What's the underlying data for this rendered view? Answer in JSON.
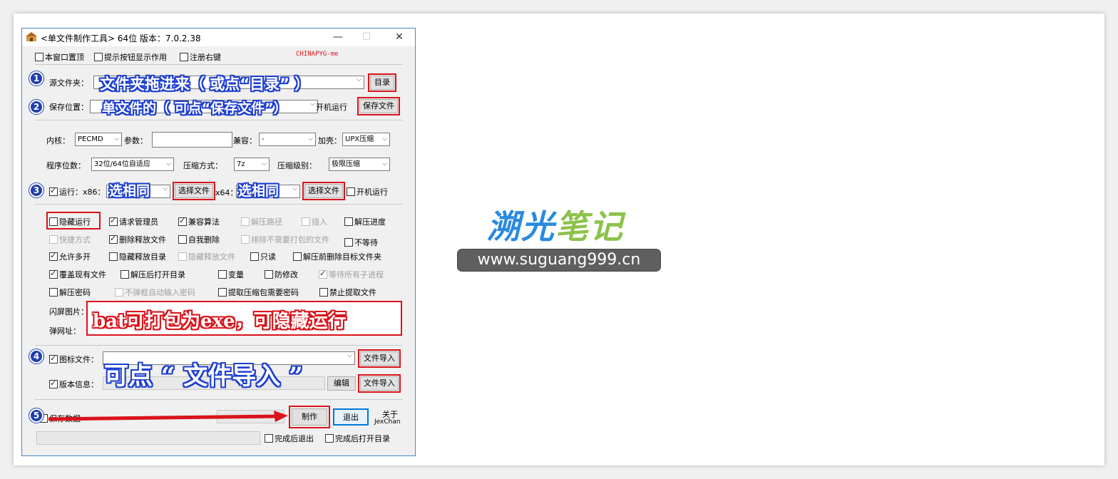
{
  "window": {
    "title": "<单文件制作工具> 64位 版本：7.0.2.38",
    "watermark": "CHINAPYG-me"
  },
  "top_options": [
    "本窗口置顶",
    "提示按钮显示作用",
    "注册右键"
  ],
  "rows": {
    "source_label": "源文件夹：",
    "source_button": "目录",
    "save_label": "保存位置：",
    "autostart_label": "开机运行",
    "save_button": "保存文件"
  },
  "settings": {
    "kernel_label": "内核：",
    "kernel_value": "PECMD",
    "params_label": "参数：",
    "compat_label": "兼容：",
    "compat_value": "-",
    "shell_label": "加壳：",
    "shell_value": "UPX压缩",
    "bits_label": "程序位数：",
    "bits_value": "32位/64位自适应",
    "compress_label": "压缩方式：",
    "compress_value": "7z",
    "level_label": "压缩级别：",
    "level_value": "极限压缩"
  },
  "run_row": {
    "run_label": "运行：x86：",
    "select_button_1": "选择文件",
    "x64_label": "x64：",
    "select_button_2": "选择文件",
    "autostart": "开机运行"
  },
  "options": [
    {
      "label": "隐藏运行",
      "checked": false,
      "disabled": false
    },
    {
      "label": "请求管理员",
      "checked": true,
      "disabled": false
    },
    {
      "label": "兼容算法",
      "checked": true,
      "disabled": false
    },
    {
      "label": "解压路径",
      "checked": false,
      "disabled": true
    },
    {
      "label": "插入",
      "checked": false,
      "disabled": true
    },
    {
      "label": "解压进度",
      "checked": false,
      "disabled": false
    },
    {
      "label": "快捷方式",
      "checked": false,
      "disabled": true
    },
    {
      "label": "删除释放文件",
      "checked": true,
      "disabled": false
    },
    {
      "label": "自我删除",
      "checked": false,
      "disabled": false
    },
    {
      "label": "排除不需要打包的文件",
      "checked": false,
      "disabled": true
    },
    {
      "label": "不等待",
      "checked": false,
      "disabled": false
    },
    {
      "label": "允许多开",
      "checked": true,
      "disabled": false
    },
    {
      "label": "隐藏释放目录",
      "checked": false,
      "disabled": false
    },
    {
      "label": "隐藏释放文件",
      "checked": false,
      "disabled": true
    },
    {
      "label": "只读",
      "checked": false,
      "disabled": false
    },
    {
      "label": "解压前删除目标文件夹",
      "checked": false,
      "disabled": false
    },
    {
      "label": "覆盖现有文件",
      "checked": true,
      "disabled": false
    },
    {
      "label": "解压后打开目录",
      "checked": false,
      "disabled": false
    },
    {
      "label": "变量",
      "checked": false,
      "disabled": false
    },
    {
      "label": "防修改",
      "checked": false,
      "disabled": false
    },
    {
      "label": "等待所有子进程",
      "checked": true,
      "disabled": true
    },
    {
      "label": "解压密码",
      "checked": false,
      "disabled": false
    },
    {
      "label": "不弹框自动输入密码",
      "checked": false,
      "disabled": true
    },
    {
      "label": "提取压缩包需要密码",
      "checked": false,
      "disabled": false
    },
    {
      "label": "禁止提取文件",
      "checked": false,
      "disabled": false
    }
  ],
  "splash_label": "闪屏图片：",
  "popup_label": "弹网址：",
  "icon_label": "图标文件：",
  "import_button_1": "文件导入",
  "version_label": "版本信息：",
  "edit_button": "编辑",
  "import_button_2": "文件导入",
  "bottom": {
    "save_data": "保存数据",
    "make_button": "制作",
    "exit_button": "退出",
    "about_1": "关于",
    "about_2": "JexChan",
    "done_exit": "完成后退出",
    "done_open": "完成后打开目录"
  },
  "annotations": {
    "n1": "1",
    "n2": "2",
    "n3": "3",
    "n4": "4",
    "n5": "5",
    "a1": "文件夹拖进来（ 或点“目录” ）",
    "a2": "单文件的（ 可点“保存文件”）",
    "a3": "选相同",
    "a4": "选相同",
    "a5": "bat可打包为exe，可隐藏运行",
    "a6": "可点 “ 文件导入 ”"
  },
  "brand": {
    "part1": "溯光",
    "part2": "笔记",
    "url": "www.suguang999.cn"
  },
  "colors": {
    "annotation_red": "#d9131b",
    "annotation_blue": "#1e3fd0",
    "brand_blue": "#2a8ae0",
    "brand_green": "#8bc34a"
  }
}
